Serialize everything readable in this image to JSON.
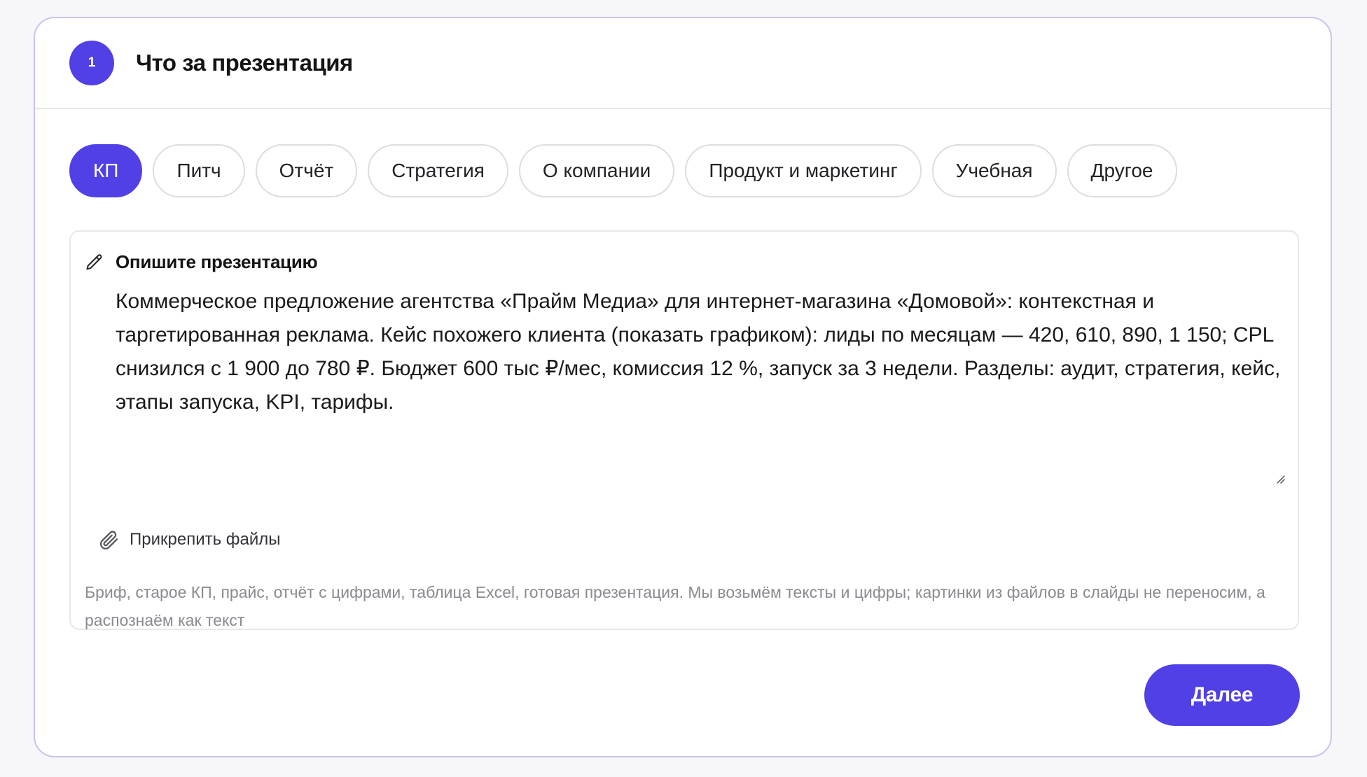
{
  "step": {
    "number": "1",
    "title": "Что за презентация"
  },
  "types": [
    {
      "label": "КП",
      "selected": true
    },
    {
      "label": "Питч",
      "selected": false
    },
    {
      "label": "Отчёт",
      "selected": false
    },
    {
      "label": "Стратегия",
      "selected": false
    },
    {
      "label": "О компании",
      "selected": false
    },
    {
      "label": "Продукт и маркетинг",
      "selected": false
    },
    {
      "label": "Учебная",
      "selected": false
    },
    {
      "label": "Другое",
      "selected": false
    }
  ],
  "description": {
    "label": "Опишите презентацию",
    "label_icon": "pencil-icon",
    "value": "Коммерческое предложение агентства «Прайм Медиа» для интернет-магазина «Домовой»: контекстная и таргетированная реклама. Кейс похожего клиента (показать графиком): лиды по месяцам — 420, 610, 890, 1 150; CPL снизился с 1 900 до 780 ₽. Бюджет 600 тыс ₽/мес, комиссия 12 %, запуск за 3 недели. Разделы: аудит, стратегия, кейс, этапы запуска, KPI, тарифы."
  },
  "attach": {
    "label": "Прикрепить файлы",
    "icon": "paperclip-icon"
  },
  "hint": "Бриф, старое КП, прайс, отчёт с цифрами, таблица Excel, готовая презентация. Мы возьмём тексты и цифры; картинки из файлов в слайды не переносим, а распознаём как текст",
  "next_button": "Далее",
  "colors": {
    "accent": "#5040e6",
    "card_border": "#c9c3f0",
    "hint_text": "#8a8a90"
  }
}
